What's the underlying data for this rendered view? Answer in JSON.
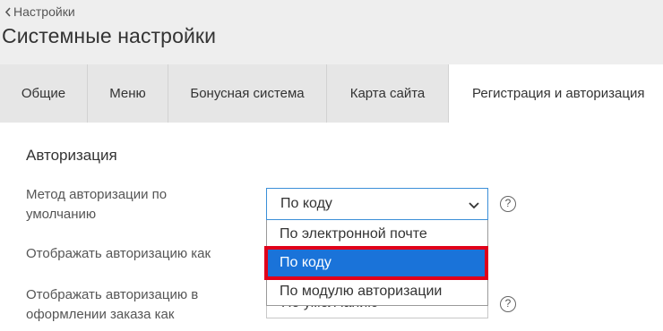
{
  "header": {
    "back_label": "Настройки",
    "title": "Системные настройки"
  },
  "tabs": [
    {
      "label": "Общие",
      "active": false
    },
    {
      "label": "Меню",
      "active": false
    },
    {
      "label": "Бонусная система",
      "active": false
    },
    {
      "label": "Карта сайта",
      "active": false
    },
    {
      "label": "Регистрация и авторизация",
      "active": true
    }
  ],
  "section": {
    "title": "Авторизация"
  },
  "fields": {
    "auth_method_label": "Метод авторизации по умолчанию",
    "auth_method_value": "По коду",
    "display_auth_label": "Отображать авторизацию как",
    "display_auth_order_label": "Отображать авторизацию в оформлении заказа как",
    "display_auth_order_value": "По умолчанию"
  },
  "dropdown": {
    "options": [
      "По электронной почте",
      "По коду",
      "По модулю авторизации"
    ],
    "selected": "По коду"
  },
  "help_glyph": "?",
  "colors": {
    "header_bg": "#eeeeee",
    "tab_bg": "#e6e6e6",
    "selected_option": "#1a73d9",
    "highlight": "#e0001a",
    "focus_border": "#3b8fd8"
  }
}
